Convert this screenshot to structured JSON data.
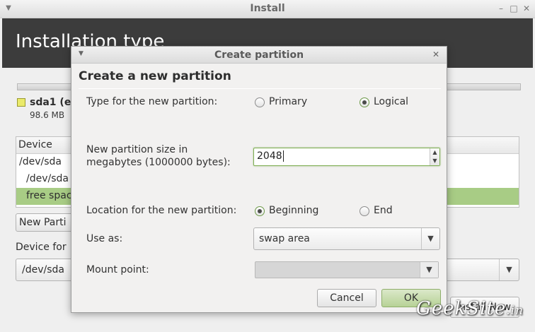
{
  "window": {
    "title": "Install",
    "header_title": "Installation type"
  },
  "disk": {
    "legend_name": "sda1 (e",
    "legend_size": "98.6 MB",
    "legend_color": "#eaea6a"
  },
  "table": {
    "header": "Device",
    "rows": [
      "/dev/sda",
      "/dev/sda",
      "free spac"
    ],
    "selected_color": "#a8cc85"
  },
  "main": {
    "new_partition_label": "New Parti",
    "device_for_label": "Device for",
    "device_select_value": "/dev/sda",
    "install_now_label": "Install Now"
  },
  "dialog": {
    "title": "Create partition",
    "heading": "Create a new partition",
    "type_label": "Type for the new partition:",
    "type_options": [
      {
        "label": "Primary",
        "selected": false
      },
      {
        "label": "Logical",
        "selected": true
      }
    ],
    "size_label_line1": "New partition size in",
    "size_label_line2": "megabytes (1000000 bytes):",
    "size_value": "2048",
    "location_label": "Location for the new partition:",
    "location_options": [
      {
        "label": "Beginning",
        "selected": true
      },
      {
        "label": "End",
        "selected": false
      }
    ],
    "use_as_label": "Use as:",
    "use_as_value": "swap area",
    "mount_label": "Mount point:",
    "mount_value": "",
    "cancel_label": "Cancel",
    "ok_label": "OK",
    "accent_color": "#b7d296"
  },
  "watermark": {
    "text": "GeekSite",
    "suffix": ".in"
  }
}
